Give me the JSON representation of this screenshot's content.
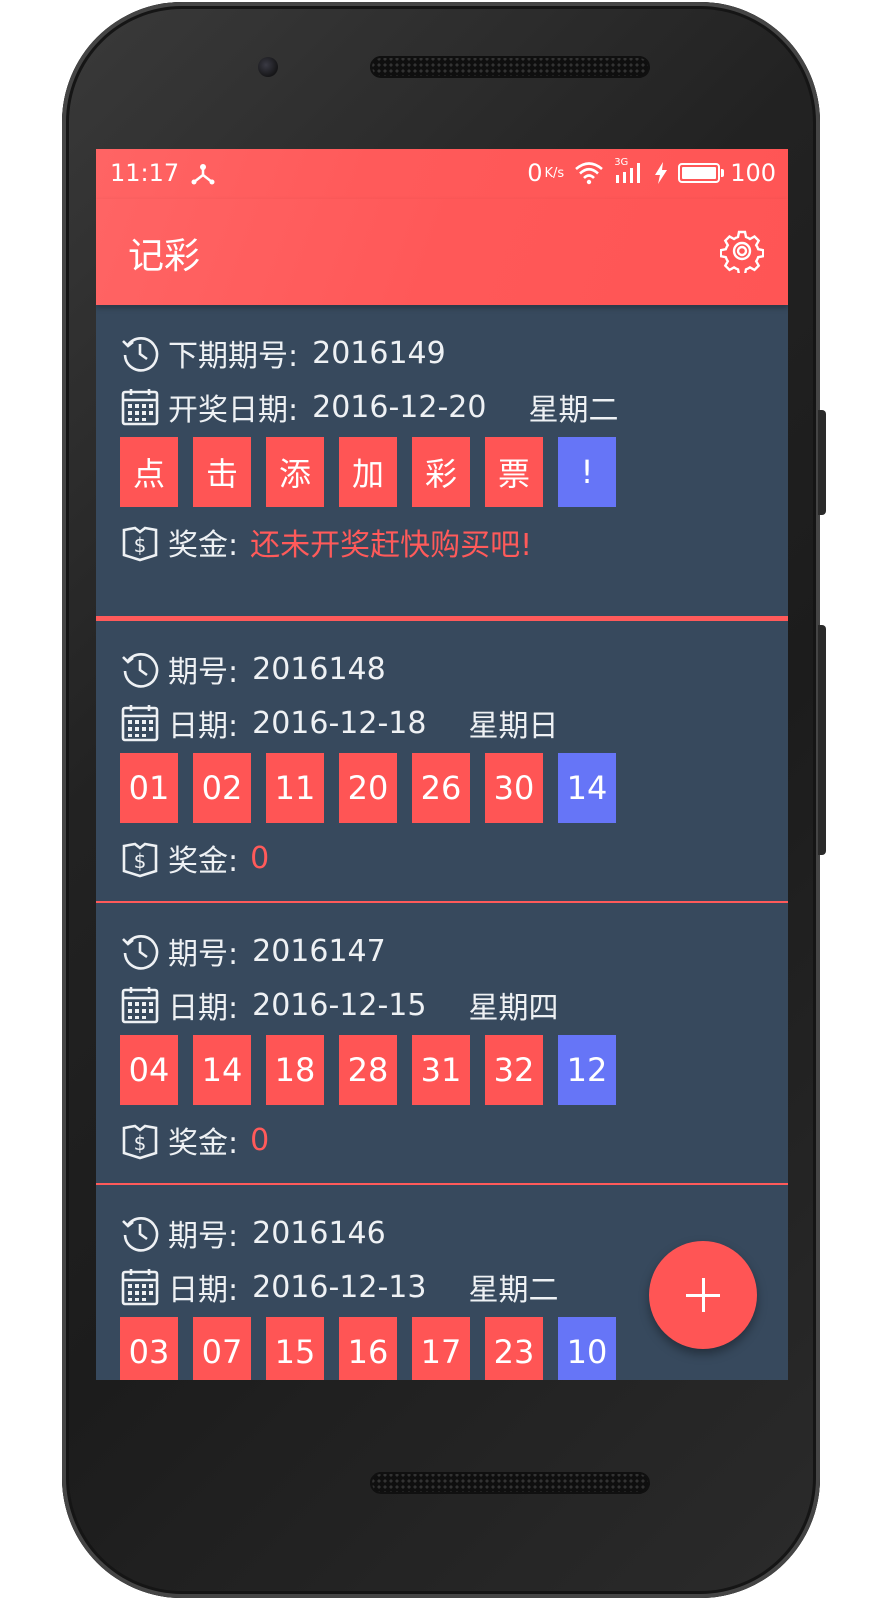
{
  "status_bar": {
    "time": "11:17",
    "net_speed": "0",
    "net_unit": "K/s",
    "net_type": "3G",
    "battery": "100",
    "icons": [
      "usb-icon",
      "wifi-icon",
      "signal-icon",
      "charging-icon",
      "battery-icon"
    ]
  },
  "app_bar": {
    "title": "记彩",
    "settings_icon": "gear-icon"
  },
  "next_draw": {
    "issue_label": "下期期号:",
    "issue": "2016149",
    "date_label": "开奖日期:",
    "date": "2016-12-20",
    "weekday": "星期二",
    "prompt_chars": [
      "点",
      "击",
      "添",
      "加",
      "彩",
      "票"
    ],
    "prompt_blue": "!",
    "prize_label": "奖金:",
    "prize_text": "还未开奖赶快购买吧!"
  },
  "draws": [
    {
      "issue_label": "期号:",
      "issue": "2016148",
      "date_label": "日期:",
      "date": "2016-12-18",
      "weekday": "星期日",
      "red": [
        "01",
        "02",
        "11",
        "20",
        "26",
        "30"
      ],
      "blue": "14",
      "prize_label": "奖金:",
      "prize": "0"
    },
    {
      "issue_label": "期号:",
      "issue": "2016147",
      "date_label": "日期:",
      "date": "2016-12-15",
      "weekday": "星期四",
      "red": [
        "04",
        "14",
        "18",
        "28",
        "31",
        "32"
      ],
      "blue": "12",
      "prize_label": "奖金:",
      "prize": "0"
    },
    {
      "issue_label": "期号:",
      "issue": "2016146",
      "date_label": "日期:",
      "date": "2016-12-13",
      "weekday": "星期二",
      "red": [
        "03",
        "07",
        "15",
        "16",
        "17",
        "23"
      ],
      "blue": "10",
      "prize_label": "",
      "prize": ""
    }
  ],
  "fab": {
    "icon": "plus-icon"
  },
  "colors": {
    "accent": "#ff5555",
    "blue_ball": "#6675f7",
    "card_bg": "#37495d",
    "text": "#eef1f4"
  }
}
